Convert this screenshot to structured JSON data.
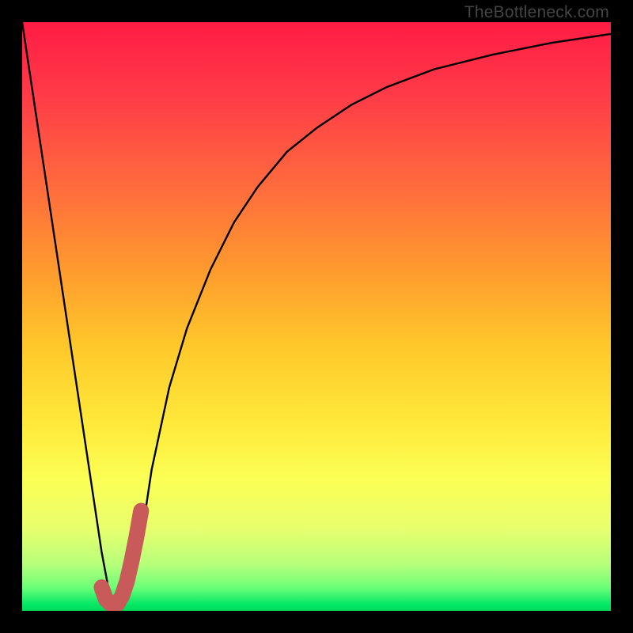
{
  "watermark": {
    "text": "TheBottleneck.com"
  },
  "colors": {
    "curve_stroke": "#000000",
    "marker_stroke": "#c85a5a",
    "gradient_top": "#ff1c44",
    "gradient_bottom": "#00d85c",
    "frame_bg": "#000000"
  },
  "chart_data": {
    "type": "line",
    "title": "",
    "xlabel": "",
    "ylabel": "",
    "xlim": [
      0,
      100
    ],
    "ylim": [
      0,
      100
    ],
    "grid": false,
    "series": [
      {
        "name": "bottleneck-curve",
        "x": [
          0,
          3,
          6,
          9,
          12,
          13.5,
          15,
          17,
          18,
          19,
          20.5,
          22,
          25,
          28,
          32,
          36,
          40,
          45,
          50,
          56,
          62,
          70,
          80,
          90,
          100
        ],
        "y": [
          100,
          80,
          60,
          40,
          20,
          10,
          2,
          1,
          2,
          6,
          14,
          24,
          38,
          48,
          58,
          66,
          72,
          78,
          82,
          86,
          89,
          92,
          94.5,
          96.5,
          98
        ]
      }
    ],
    "marker": {
      "name": "j-hook",
      "x": [
        13.5,
        14.2,
        15.2,
        16.2,
        17.0,
        17.8,
        18.6,
        19.4,
        20.2
      ],
      "y": [
        4.0,
        2.0,
        1.0,
        1.2,
        2.6,
        5.0,
        8.5,
        12.5,
        17.0
      ]
    }
  }
}
